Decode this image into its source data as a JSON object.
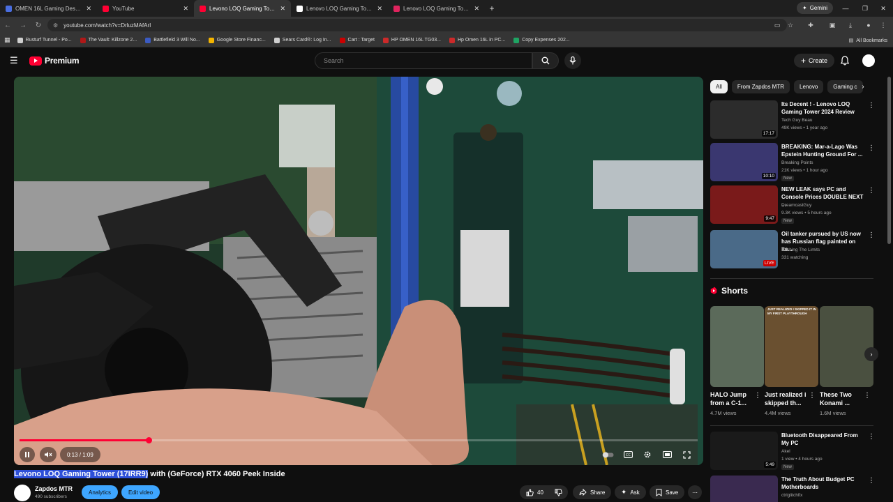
{
  "browser": {
    "tabs": [
      {
        "label": "OMEN 16L Gaming Desktop TG",
        "favicon_color": "#4a6ee0",
        "active": false
      },
      {
        "label": "YouTube",
        "favicon_color": "#ff0033",
        "active": false
      },
      {
        "label": "Levono LOQ Gaming Tower (17",
        "favicon_color": "#ff0033",
        "active": true
      },
      {
        "label": "Lenovo LOQ Gaming Tower (17",
        "favicon_color": "#ffffff",
        "active": false
      },
      {
        "label": "Lenovo LOQ Gaming Tower (20",
        "favicon_color": "#e0245e",
        "active": false
      }
    ],
    "new_tab": "+",
    "gemini_label": "Gemini",
    "url": "youtube.com/watch?v=DrluzMAfArI",
    "bookmarks": [
      {
        "label": "Rusturf Tunnel - Po...",
        "color": "#cfcfcf"
      },
      {
        "label": "The Vault: Killzone 2...",
        "color": "#b01818"
      },
      {
        "label": "Battlefield 3 Will No...",
        "color": "#3b5bc2"
      },
      {
        "label": "Google Store Financ...",
        "color": "#f4b400"
      },
      {
        "label": "Sears Card®: Log In...",
        "color": "#cfcfcf"
      },
      {
        "label": "Cart : Target",
        "color": "#cc0000"
      },
      {
        "label": "HP OMEN 16L TG03...",
        "color": "#cc2a2a"
      },
      {
        "label": "Hp Omen 16L in PC...",
        "color": "#cc2a2a"
      },
      {
        "label": "Copy Expenses 202...",
        "color": "#1fa463"
      }
    ],
    "all_bookmarks": "All Bookmarks"
  },
  "youtube": {
    "logo_text": "Premium",
    "search_placeholder": "Search",
    "create_label": "Create",
    "player": {
      "time": "0:13 / 1:09",
      "progress_fraction": 0.19
    },
    "video_title_highlighted": "Levono LOQ Gaming Tower (17IRR9)",
    "video_title_rest": " with (GeForce) RTX 4060 Peek Inside",
    "channel_name": "Zapdos MTR",
    "subscribers": "490 subscribers",
    "analytics_label": "Analytics",
    "edit_label": "Edit video",
    "likes": "40",
    "share_label": "Share",
    "ask_label": "Ask",
    "save_label": "Save",
    "chips": [
      "All",
      "From Zapdos MTR",
      "Lenovo",
      "Gaming c"
    ],
    "recommendations": [
      {
        "title": "Its Decent ! - Lenovo LOQ Gaming Tower 2024 Review",
        "channel": "Tech Guy Beau",
        "meta": "49K views • 1 year ago",
        "duration": "17:17",
        "new": "",
        "thumb": "#2c2c2c"
      },
      {
        "title": "BREAKING: Mar-a-Lago Was Epstein Hunting Ground For ...",
        "channel": "Breaking Points",
        "meta": "21K views • 1 hour ago",
        "duration": "10:10",
        "new": "New",
        "thumb": "#3a3770"
      },
      {
        "title": "NEW LEAK says PC and Console Prices DOUBLE NEXT ...",
        "channel": "DreamcastGuy",
        "meta": "9.3K views • 5 hours ago",
        "duration": "9:47",
        "new": "New",
        "thumb": "#7a1a1a"
      },
      {
        "title": "Oil tanker pursued by US now has Russian flag painted on its...",
        "channel": "Pushing The Limits",
        "meta": "331 watching",
        "duration": "LIVE",
        "new": "",
        "thumb": "#4a6a88"
      },
      {
        "title": "Bluetooth Disappeared From My PC",
        "channel": "Akel",
        "meta": "1 view • 4 hours ago",
        "duration": "5:49",
        "new": "New",
        "thumb": "#1a1a1a"
      },
      {
        "title": "The Truth About Budget PC Motherboards",
        "channel": "ctrlglitchfix",
        "meta": "",
        "duration": "",
        "new": "",
        "thumb": "#3a2a50"
      }
    ],
    "shorts_heading": "Shorts",
    "shorts": [
      {
        "title": "HALO Jump from a C-1...",
        "views": "4.7M views",
        "thumb": "#5b6a5a",
        "caption": ""
      },
      {
        "title": "Just realized i skipped th...",
        "views": "4.4M views",
        "thumb": "#6a5030",
        "caption": "JUST REALIZED I SKIPPED IT IN MY FIRST PLAYTHROUGH"
      },
      {
        "title": "These Two Konami ...",
        "views": "1.6M views",
        "thumb": "#4a5040",
        "caption": ""
      }
    ]
  }
}
